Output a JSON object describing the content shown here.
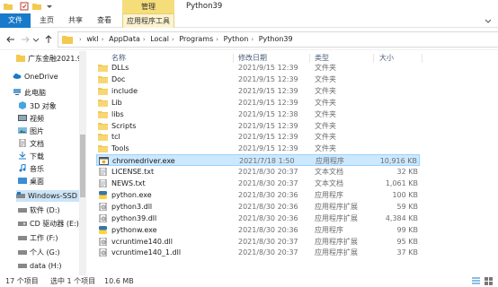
{
  "title_bar": {
    "manage_tab": "管理",
    "window_title": "Python39"
  },
  "ribbon": {
    "tabs": [
      "文件",
      "主页",
      "共享",
      "查看",
      "应用程序工具"
    ]
  },
  "address": {
    "crumbs": [
      "wkl",
      "AppData",
      "Local",
      "Programs",
      "Python",
      "Python39"
    ]
  },
  "nav_pane": {
    "items": [
      {
        "label": "广东金融2021.9",
        "icon": "folder-icon"
      },
      {
        "label": "OneDrive",
        "icon": "cloud-icon"
      },
      {
        "label": "此电脑",
        "icon": "computer-icon"
      },
      {
        "label": "3D 对象",
        "icon": "cube-icon"
      },
      {
        "label": "视频",
        "icon": "video-icon"
      },
      {
        "label": "图片",
        "icon": "picture-icon"
      },
      {
        "label": "文档",
        "icon": "document-icon"
      },
      {
        "label": "下载",
        "icon": "download-icon"
      },
      {
        "label": "音乐",
        "icon": "music-icon"
      },
      {
        "label": "桌面",
        "icon": "desktop-icon"
      },
      {
        "label": "Windows-SSD (",
        "icon": "drive-icon"
      },
      {
        "label": "软件 (D:)",
        "icon": "drive-icon"
      },
      {
        "label": "CD 驱动器 (E:)",
        "icon": "cd-drive-icon"
      },
      {
        "label": "工作 (F:)",
        "icon": "drive-icon"
      },
      {
        "label": "个人 (G:)",
        "icon": "drive-icon"
      },
      {
        "label": "data (H:)",
        "icon": "drive-icon"
      }
    ]
  },
  "columns": {
    "name": "名称",
    "date": "修改日期",
    "type": "类型",
    "size": "大小"
  },
  "files": [
    {
      "name": "DLLs",
      "date": "2021/9/15 12:39",
      "type": "文件夹",
      "size": "",
      "icon": "folder-icon"
    },
    {
      "name": "Doc",
      "date": "2021/9/15 12:39",
      "type": "文件夹",
      "size": "",
      "icon": "folder-icon"
    },
    {
      "name": "include",
      "date": "2021/9/15 12:39",
      "type": "文件夹",
      "size": "",
      "icon": "folder-icon"
    },
    {
      "name": "Lib",
      "date": "2021/9/15 12:39",
      "type": "文件夹",
      "size": "",
      "icon": "folder-icon"
    },
    {
      "name": "libs",
      "date": "2021/9/15 12:38",
      "type": "文件夹",
      "size": "",
      "icon": "folder-icon"
    },
    {
      "name": "Scripts",
      "date": "2021/9/15 12:39",
      "type": "文件夹",
      "size": "",
      "icon": "folder-icon"
    },
    {
      "name": "tcl",
      "date": "2021/9/15 12:39",
      "type": "文件夹",
      "size": "",
      "icon": "folder-icon"
    },
    {
      "name": "Tools",
      "date": "2021/9/15 12:39",
      "type": "文件夹",
      "size": "",
      "icon": "folder-icon"
    },
    {
      "name": "chromedriver.exe",
      "date": "2021/7/18 1:50",
      "type": "应用程序",
      "size": "10,916 KB",
      "icon": "exe-icon"
    },
    {
      "name": "LICENSE.txt",
      "date": "2021/8/30 20:37",
      "type": "文本文档",
      "size": "32 KB",
      "icon": "text-file-icon"
    },
    {
      "name": "NEWS.txt",
      "date": "2021/8/30 20:37",
      "type": "文本文档",
      "size": "1,061 KB",
      "icon": "text-file-icon"
    },
    {
      "name": "python.exe",
      "date": "2021/8/30 20:36",
      "type": "应用程序",
      "size": "100 KB",
      "icon": "python-icon"
    },
    {
      "name": "python3.dll",
      "date": "2021/8/30 20:36",
      "type": "应用程序扩展",
      "size": "59 KB",
      "icon": "dll-icon"
    },
    {
      "name": "python39.dll",
      "date": "2021/8/30 20:36",
      "type": "应用程序扩展",
      "size": "4,384 KB",
      "icon": "dll-icon"
    },
    {
      "name": "pythonw.exe",
      "date": "2021/8/30 20:36",
      "type": "应用程序",
      "size": "99 KB",
      "icon": "python-icon"
    },
    {
      "name": "vcruntime140.dll",
      "date": "2021/8/30 20:37",
      "type": "应用程序扩展",
      "size": "95 KB",
      "icon": "dll-icon"
    },
    {
      "name": "vcruntime140_1.dll",
      "date": "2021/8/30 20:37",
      "type": "应用程序扩展",
      "size": "37 KB",
      "icon": "dll-icon"
    }
  ],
  "status": {
    "count": "17 个项目",
    "selected": "选中 1 个项目",
    "size": "10.6 MB"
  },
  "colors": {
    "accent": "#1979ca",
    "selection": "#cce8ff",
    "manage_tab": "#f5dd7a",
    "folder": "#f3c94e"
  }
}
